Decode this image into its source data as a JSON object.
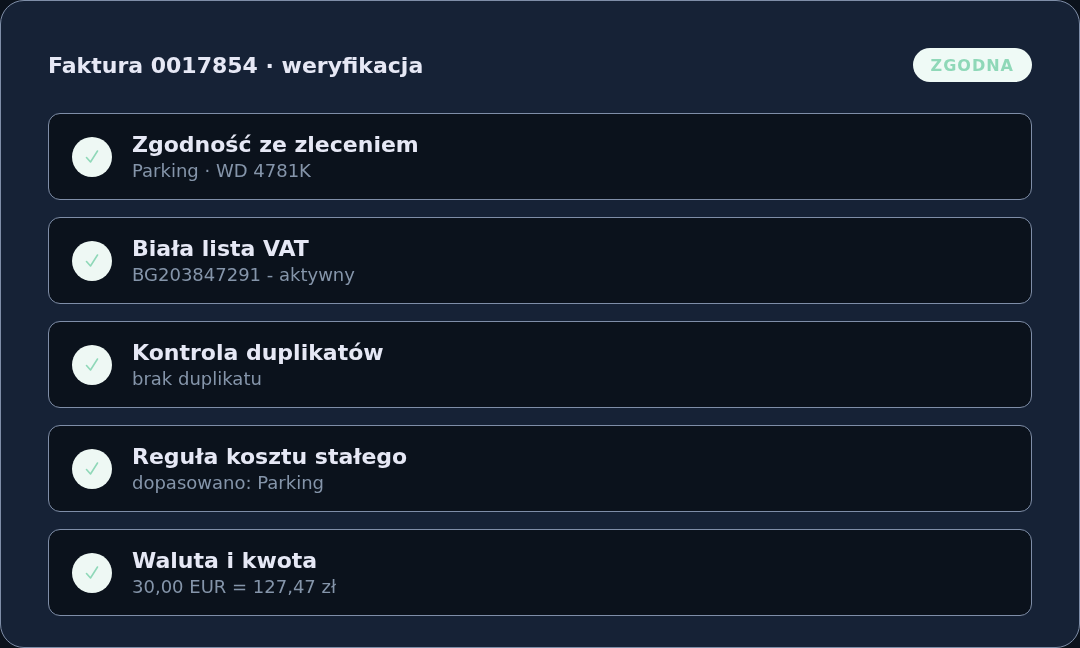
{
  "header": {
    "title": "Faktura 0017854 · weryfikacja",
    "badge": "ZGODNA"
  },
  "checks": [
    {
      "title": "Zgodność ze zleceniem",
      "detail": "Parking · WD 4781K",
      "passed": true
    },
    {
      "title": "Biała lista VAT",
      "detail": "BG203847291 - aktywny",
      "passed": true
    },
    {
      "title": "Kontrola duplikatów",
      "detail": "brak duplikatu",
      "passed": true
    },
    {
      "title": "Reguła kosztu stałego",
      "detail": "dopasowano: Parking",
      "passed": true
    },
    {
      "title": "Waluta i kwota",
      "detail": "30,00 EUR = 127,47 zł",
      "passed": true
    }
  ]
}
